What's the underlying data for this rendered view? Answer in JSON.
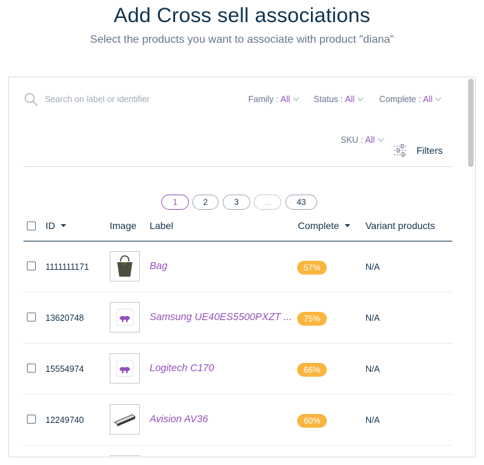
{
  "header": {
    "title": "Add Cross sell associations",
    "subtitle": "Select the products you want to associate with product \"diana\""
  },
  "search": {
    "placeholder": "Search on label or identifier"
  },
  "filters": [
    {
      "label": "Family :",
      "value": "All"
    },
    {
      "label": "Status :",
      "value": "All"
    },
    {
      "label": "Complete :",
      "value": "All"
    },
    {
      "label": "SKU :",
      "value": "All"
    }
  ],
  "filters_button": {
    "label": "Filters"
  },
  "pagination": {
    "pages": [
      "1",
      "2",
      "3",
      "...",
      "43"
    ],
    "current": "1"
  },
  "table": {
    "columns": [
      "ID",
      "Image",
      "Label",
      "Complete",
      "Variant products"
    ],
    "rows": [
      {
        "id": "1111111171",
        "image": "bag-image",
        "label": "Bag",
        "complete": "57%",
        "variants": "N/A"
      },
      {
        "id": "13620748",
        "image": "placeholder-image",
        "label": "Samsung UE40ES5500PXZT ...",
        "complete": "75%",
        "variants": "N/A"
      },
      {
        "id": "15554974",
        "image": "placeholder-image",
        "label": "Logitech C170",
        "complete": "66%",
        "variants": "N/A"
      },
      {
        "id": "12249740",
        "image": "scanner-image",
        "label": "Avision AV36",
        "complete": "60%",
        "variants": "N/A"
      }
    ]
  },
  "colors": {
    "accent": "#9452ba",
    "badge": "#f9b53f",
    "text": "#11324d",
    "muted": "#67768a"
  }
}
